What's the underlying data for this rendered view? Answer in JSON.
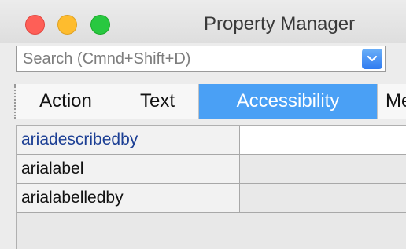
{
  "window": {
    "title": "Property Manager",
    "controls": [
      "close",
      "minimize",
      "zoom"
    ]
  },
  "search": {
    "placeholder": "Search (Cmnd+Shift+D)",
    "value": "",
    "dropdown_icon": "chevron-down-icon"
  },
  "tabs": [
    {
      "label": "Action",
      "active": false
    },
    {
      "label": "Text",
      "active": false
    },
    {
      "label": "Accessibility",
      "active": true
    },
    {
      "label": "Me",
      "active": false
    }
  ],
  "properties": [
    {
      "name": "ariadescribedby",
      "value": "",
      "selected": true
    },
    {
      "name": "arialabel",
      "value": "",
      "selected": false
    },
    {
      "name": "arialabelledby",
      "value": "",
      "selected": false
    }
  ],
  "colors": {
    "accent": "#4aa0f5",
    "selected_text": "#1c3f94",
    "close": "#fe5f57",
    "minimize": "#febc2e",
    "zoom": "#28c840"
  }
}
